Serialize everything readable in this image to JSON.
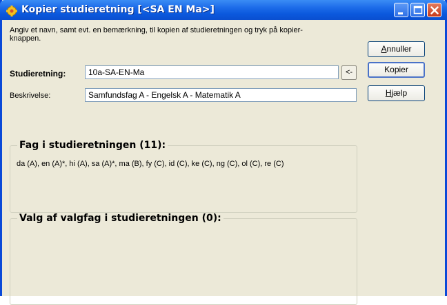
{
  "window": {
    "title": "Kopier studieretning [<SA EN Ma>]",
    "icons": {
      "app": "gear-icon",
      "minimize": "minimize-icon",
      "maximize": "maximize-icon",
      "close": "close-icon"
    }
  },
  "form": {
    "instruction": "Angiv et navn, samt evt. en bemærkning, til kopien af studieretningen og tryk på kopier-knappen.",
    "studieretning": {
      "label": "Studieretning:",
      "value": "10a-SA-EN-Ma",
      "arrow_label": "<-"
    },
    "beskrivelse": {
      "label": "Beskrivelse:",
      "value": "Samfundsfag A - Engelsk A - Matematik A"
    }
  },
  "buttons": {
    "annuller": {
      "accel": "A",
      "rest": "nnuller"
    },
    "kopier": {
      "label": "Kopier"
    },
    "hjaelp": {
      "accel": "H",
      "rest": "jælp"
    }
  },
  "groups": {
    "fag": {
      "title": "Fag i studieretningen (11):",
      "content": "da (A), en (A)*, hi (A), sa (A)*, ma (B), fy (C), id (C), ke (C), ng (C), ol (C), re (C)"
    },
    "valgfag": {
      "title": "Valg af valgfag i studieretningen (0):",
      "content": ""
    }
  },
  "colors": {
    "titlebar": "#0a58dd",
    "window_bg": "#ece9d8",
    "close_button": "#c6391a"
  }
}
